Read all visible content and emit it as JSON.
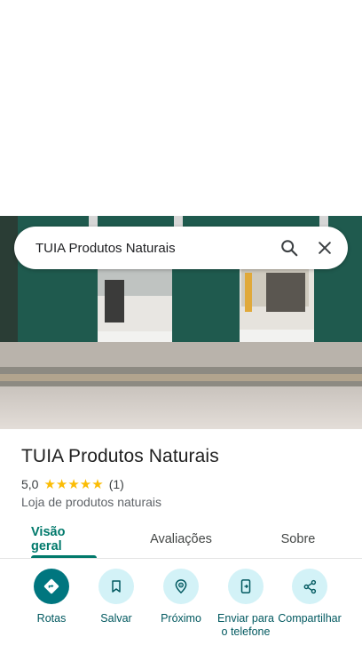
{
  "search": {
    "query": "TUIA Produtos Naturais",
    "search_icon": "search-icon",
    "close_icon": "close-icon"
  },
  "place": {
    "name": "TUIA Produtos Naturais",
    "rating": "5,0",
    "stars": "★★★★★",
    "review_count": "(1)",
    "category": "Loja de produtos naturais"
  },
  "tabs": [
    {
      "label": "Visão geral",
      "active": true
    },
    {
      "label": "Avaliações",
      "active": false
    },
    {
      "label": "Sobre",
      "active": false
    }
  ],
  "actions": [
    {
      "label": "Rotas",
      "icon": "directions-icon"
    },
    {
      "label": "Salvar",
      "icon": "bookmark-icon"
    },
    {
      "label": "Próximo",
      "icon": "nearby-icon"
    },
    {
      "label": "Enviar para o telefone",
      "icon": "send-to-phone-icon"
    },
    {
      "label": "Compartilhar",
      "icon": "share-icon"
    }
  ],
  "colors": {
    "accent": "#00796b",
    "action_primary": "#00767f",
    "action_secondary_bg": "#d3f2f7",
    "stars": "#fbbc04",
    "storefront_green": "#1f5a4e"
  }
}
